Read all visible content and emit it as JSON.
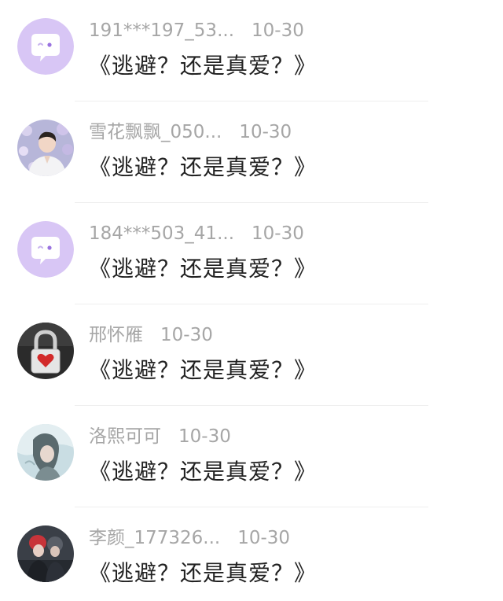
{
  "comments": [
    {
      "username": "191***197_53...",
      "time": "10-30",
      "text": "《逃避？还是真爱？》",
      "avatar": "default-chat-avatar"
    },
    {
      "username": "雪花飘飘_050...",
      "time": "10-30",
      "text": "《逃避？还是真爱？》",
      "avatar": "photo-avatar-man-flowers"
    },
    {
      "username": "184***503_41...",
      "time": "10-30",
      "text": "《逃避？还是真爱？》",
      "avatar": "default-chat-avatar"
    },
    {
      "username": "邢怀雁",
      "time": "10-30",
      "text": "《逃避？还是真爱？》",
      "avatar": "photo-avatar-heart-lock"
    },
    {
      "username": "洛熙可可",
      "time": "10-30",
      "text": "《逃避？还是真爱？》",
      "avatar": "photo-avatar-anime-character"
    },
    {
      "username": "李颜_177326...",
      "time": "10-30",
      "text": "《逃避？还是真爱？》",
      "avatar": "photo-avatar-couple"
    }
  ],
  "colors": {
    "default_avatar_bg": "#d8c6f5",
    "username": "#a6a6a6",
    "comment_text": "#222222"
  }
}
